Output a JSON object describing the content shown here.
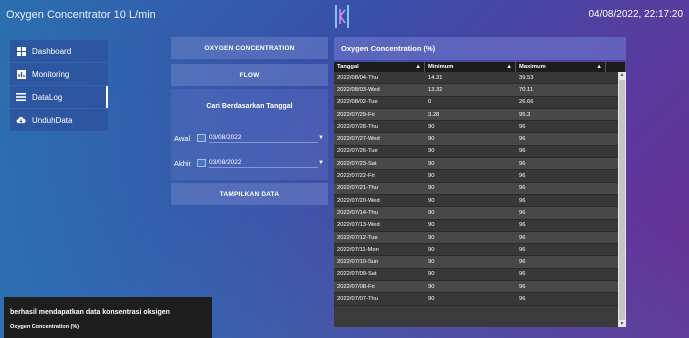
{
  "header": {
    "app_title": "Oxygen Concentrator 10 L/min",
    "datetime": "04/08/2022, 22:17:20"
  },
  "sidebar": {
    "items": [
      {
        "label": "Dashboard",
        "icon": "grid-icon"
      },
      {
        "label": "Monitoring",
        "icon": "chart-icon"
      },
      {
        "label": "DataLog",
        "icon": "list-icon"
      },
      {
        "label": "UnduhData",
        "icon": "cloud-download-icon"
      }
    ]
  },
  "controls": {
    "oxygen_btn": "OXYGEN CONCENTRATION",
    "flow_btn": "FLOW",
    "search_title": "Cari Berdasarkan Tanggal",
    "start_label": "Awal",
    "start_value": "03/08/2022",
    "end_label": "Akhir",
    "end_value": "03/08/2022",
    "show_btn": "TAMPILKAN DATA"
  },
  "grid": {
    "title": "Oxygen Concentration (%)",
    "columns": [
      "Tanggal",
      "Minimum",
      "Maximum"
    ],
    "rows": [
      [
        "2022/08/04-Thu",
        "14.31",
        "39.53"
      ],
      [
        "2022/08/03-Wed",
        "13.32",
        "70.11"
      ],
      [
        "2022/08/02-Tue",
        "0",
        "26.66"
      ],
      [
        "2022/07/29-Fri",
        "3.28",
        "95.3"
      ],
      [
        "2022/07/28-Thu",
        "90",
        "96"
      ],
      [
        "2022/07/27-Wed",
        "90",
        "96"
      ],
      [
        "2022/07/26-Tue",
        "90",
        "96"
      ],
      [
        "2022/07/23-Sat",
        "90",
        "96"
      ],
      [
        "2022/07/22-Fri",
        "90",
        "96"
      ],
      [
        "2022/07/21-Thu",
        "90",
        "96"
      ],
      [
        "2022/07/20-Wed",
        "90",
        "96"
      ],
      [
        "2022/07/14-Thu",
        "90",
        "96"
      ],
      [
        "2022/07/13-Wed",
        "90",
        "96"
      ],
      [
        "2022/07/12-Tue",
        "90",
        "96"
      ],
      [
        "2022/07/11-Mon",
        "90",
        "96"
      ],
      [
        "2022/07/10-Sun",
        "90",
        "96"
      ],
      [
        "2022/07/09-Sat",
        "90",
        "96"
      ],
      [
        "2022/07/08-Fri",
        "90",
        "96"
      ],
      [
        "2022/07/07-Thu",
        "90",
        "96"
      ]
    ]
  },
  "toast": {
    "message": "berhasil mendapatkan data konsentrasi oksigen",
    "subtitle": "Oxygen Concentration (%)"
  }
}
